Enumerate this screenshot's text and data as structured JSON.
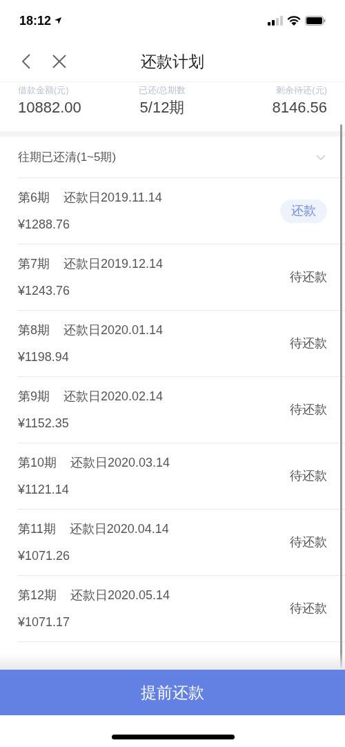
{
  "status_bar": {
    "time": "18:12"
  },
  "nav": {
    "title": "还款计划"
  },
  "summary": [
    {
      "label": "借款金额(元)",
      "value": "10882.00"
    },
    {
      "label": "已还/总期数",
      "value": "5/12期"
    },
    {
      "label": "剩余待还(元)",
      "value": "8146.56"
    }
  ],
  "history": {
    "label": "往期已还清(1~5期)",
    "expanded": false
  },
  "installments": [
    {
      "period": "第6期",
      "due": "还款日2019.11.14",
      "amount": "¥1288.76",
      "kind": "pay",
      "action": "还款"
    },
    {
      "period": "第7期",
      "due": "还款日2019.12.14",
      "amount": "¥1243.76",
      "kind": "pending",
      "action": "待还款"
    },
    {
      "period": "第8期",
      "due": "还款日2020.01.14",
      "amount": "¥1198.94",
      "kind": "pending",
      "action": "待还款"
    },
    {
      "period": "第9期",
      "due": "还款日2020.02.14",
      "amount": "¥1152.35",
      "kind": "pending",
      "action": "待还款"
    },
    {
      "period": "第10期",
      "due": "还款日2020.03.14",
      "amount": "¥1121.14",
      "kind": "pending",
      "action": "待还款"
    },
    {
      "period": "第11期",
      "due": "还款日2020.04.14",
      "amount": "¥1071.26",
      "kind": "pending",
      "action": "待还款"
    },
    {
      "period": "第12期",
      "due": "还款日2020.05.14",
      "amount": "¥1071.17",
      "kind": "pending",
      "action": "待还款"
    }
  ],
  "footer_button": "提前还款"
}
